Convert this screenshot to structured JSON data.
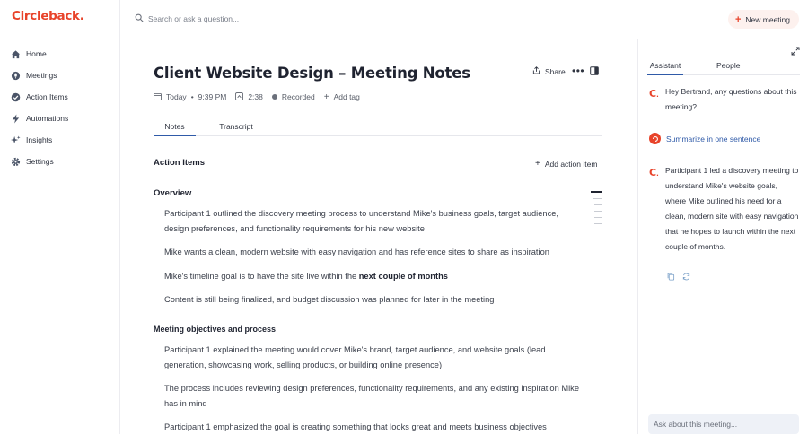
{
  "brand": {
    "logo_text": "Circleback",
    "logo_dot": ".",
    "accent": "#e8432a",
    "link_blue": "#2f5aa8"
  },
  "sidebar": {
    "items": [
      {
        "label": "Home",
        "icon": "home-icon"
      },
      {
        "label": "Meetings",
        "icon": "microphone-icon"
      },
      {
        "label": "Action Items",
        "icon": "check-circle-icon"
      },
      {
        "label": "Automations",
        "icon": "lightning-icon"
      },
      {
        "label": "Insights",
        "icon": "sparkle-icon"
      },
      {
        "label": "Settings",
        "icon": "gear-icon"
      }
    ]
  },
  "topbar": {
    "search_placeholder": "Search or ask a question...",
    "new_meeting_label": "New meeting"
  },
  "meeting": {
    "title": "Client Website Design – Meeting Notes",
    "share_label": "Share",
    "date": "Today",
    "time": "9:39 PM",
    "duration": "2:38",
    "recorded_label": "Recorded",
    "add_tag_label": "Add tag",
    "tabs": [
      "Notes",
      "Transcript"
    ],
    "action_items_heading": "Action Items",
    "add_action_item_label": "Add action item",
    "overview_heading": "Overview",
    "overview_bullets": [
      "Participant 1 outlined the discovery meeting process to understand Mike's business goals, target audience, design preferences, and functionality requirements for his new website",
      "Mike wants a clean, modern website with easy navigation and has reference sites to share as inspiration",
      "Content is still being finalized, and budget discussion was planned for later in the meeting"
    ],
    "timeline_bullet": {
      "prefix": "Mike's timeline goal is to have the site live within the ",
      "bold": "next couple of months"
    },
    "objectives_heading": "Meeting objectives and process",
    "objectives_bullets": [
      "Participant 1 explained the meeting would cover Mike's brand, target audience, and website goals (lead generation, showcasing work, selling products, or building online presence)",
      "The process includes reviewing design preferences, functionality requirements, and any existing inspiration Mike has in mind",
      "Participant 1 emphasized the goal is creating something that looks great and meets business objectives"
    ]
  },
  "assistant_panel": {
    "tabs": [
      "Assistant",
      "People"
    ],
    "greeting": "Hey Bertrand, any questions about this meeting?",
    "suggestion": "Summarize in one sentence",
    "answer": "Participant 1 led a discovery meeting to understand Mike's website goals, where Mike outlined his need for a clean, modern site with easy navigation that he hopes to launch within the next couple of months.",
    "ask_placeholder": "Ask about this meeting..."
  }
}
